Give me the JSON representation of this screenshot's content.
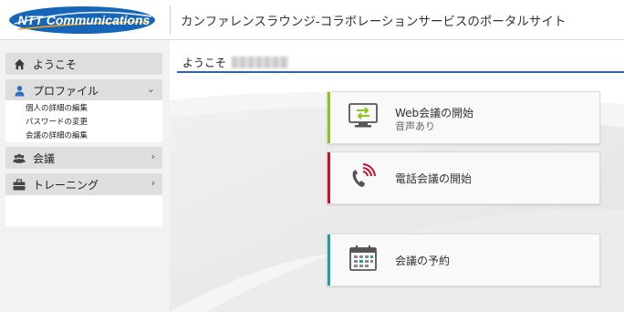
{
  "header": {
    "logo_text": "NTT Communications",
    "site_title": "カンファレンスラウンジ-コラボレーションサービスのポータルサイト"
  },
  "sidebar": {
    "items": [
      {
        "label": "ようこそ",
        "icon": "home-icon"
      },
      {
        "label": "プロファイル",
        "icon": "user-icon",
        "expanded": true
      },
      {
        "label": "会議",
        "icon": "group-icon"
      },
      {
        "label": "トレーニング",
        "icon": "briefcase-icon"
      }
    ],
    "profile_sub": [
      "個人の詳細の編集",
      "パスワードの変更",
      "会議の詳細の編集"
    ]
  },
  "main": {
    "welcome": "ようこそ",
    "cards": [
      {
        "title": "Web会議の開始",
        "subtitle": "音声あり",
        "accent": "#8dc21f",
        "icon": "monitor-arrows-icon"
      },
      {
        "title": "電話会議の開始",
        "subtitle": "",
        "accent": "#c8102e",
        "icon": "phone-icon"
      },
      {
        "title": "会議の予約",
        "subtitle": "",
        "accent": "#1aa0a0",
        "icon": "calendar-icon"
      }
    ]
  },
  "colors": {
    "brand_blue": "#1565b8",
    "welcome_rule": "#2d63a8"
  }
}
